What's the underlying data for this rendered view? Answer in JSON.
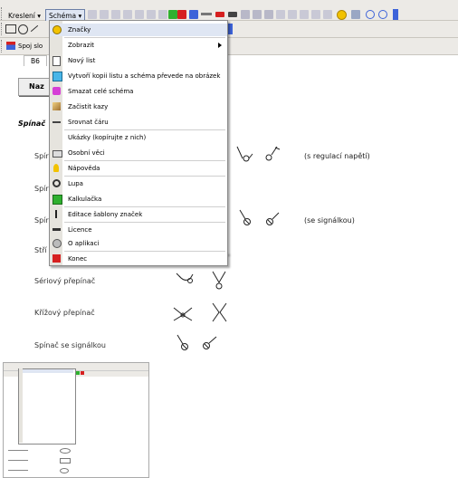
{
  "menubar": {
    "kresleni": "Kreslení ▾",
    "schema": "Schéma ▾"
  },
  "toolbar3": {
    "spoj_label": "Spoj slo"
  },
  "cellref": "B6",
  "sheet": {
    "button_label": "Naz",
    "section_label": "Spínač",
    "rows": [
      {
        "label": "Spír",
        "note": "(s regulací napětí)"
      },
      {
        "label": "Spír",
        "note": ""
      },
      {
        "label": "Spír",
        "note": "(se signálkou)"
      },
      {
        "label": "Stří",
        "note": ""
      },
      {
        "label": "Sériový přepínač",
        "note": ""
      },
      {
        "label": "Křížový přepínač",
        "note": ""
      },
      {
        "label": "Spínač se signálkou",
        "note": ""
      }
    ]
  },
  "menu": {
    "items": [
      {
        "label": "Značky",
        "icon": "circle-x-icon"
      },
      {
        "label": "Zobrazit",
        "icon": "none",
        "submenu": true
      },
      {
        "label": "Nový list",
        "icon": "new-sheet-icon"
      },
      {
        "label": "Vytvoří kopii listu a schéma převede na obrázek",
        "icon": "copy-icon"
      },
      {
        "label": "Smazat celé schéma",
        "icon": "eraser-icon"
      },
      {
        "label": "Začistit kazy",
        "icon": "clean-icon"
      },
      {
        "label": "Srovnat čáru",
        "icon": "line-icon"
      },
      {
        "label": "Ukázky (kopírujte z nich)",
        "icon": "none"
      },
      {
        "label": "Osobní věci",
        "icon": "personal-icon"
      },
      {
        "label": "Nápověda",
        "icon": "help-icon"
      },
      {
        "label": "Lupa",
        "icon": "magnifier-icon"
      },
      {
        "label": "Kalkulačka",
        "icon": "calculator-icon"
      },
      {
        "label": "Editace šablony značek",
        "icon": "exclamation-icon"
      },
      {
        "label": "Licence",
        "icon": "key-icon"
      },
      {
        "label": "O aplikaci",
        "icon": "info-icon"
      },
      {
        "label": "Konec",
        "icon": "exit-icon"
      }
    ]
  },
  "colors": {
    "menu_highlight": "#dfe6f3",
    "toolbar_bg": "#eceae6",
    "icon_yellow": "#f2c200",
    "icon_red": "#d62020"
  }
}
